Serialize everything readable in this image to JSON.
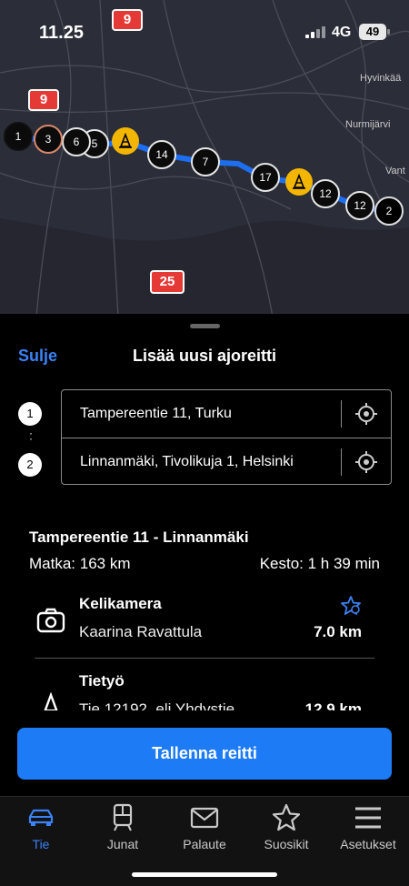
{
  "status_bar": {
    "time": "11.25",
    "network": "4G",
    "battery": "49"
  },
  "map": {
    "road_signs": [
      "9",
      "9",
      "25"
    ],
    "towns": [
      "Hyvinkää",
      "Nurmijärvi",
      "Vant"
    ],
    "markers": [
      "1",
      "3",
      "6",
      "5",
      "14",
      "7",
      "17",
      "12",
      "12",
      "2"
    ],
    "route_color": "#1e6ef0"
  },
  "sheet": {
    "close_label": "Sulje",
    "title": "Lisää uusi ajoreitti",
    "waypoints": [
      {
        "index": "1",
        "value": "Tampereentie 11, Turku"
      },
      {
        "index": "2",
        "value": "Linnanmäki, Tivolikuja 1, Helsinki"
      }
    ],
    "route": {
      "title": "Tampereentie 11  -  Linnanmäki",
      "distance": "Matka: 163 km",
      "duration": "Kesto: 1 h 39 min"
    },
    "items": [
      {
        "icon": "camera-icon",
        "name": "Kelikamera",
        "subtitle": "Kaarina Ravattula",
        "distance": "7.0 km"
      },
      {
        "icon": "roadwork-cone-icon",
        "name": "Tietyö",
        "subtitle": "Tie 12192, eli Yhdystie",
        "distance": "12.9 km"
      }
    ],
    "save_button": "Tallenna reitti"
  },
  "tabs": [
    {
      "label": "Tie",
      "icon": "car-icon",
      "active": true
    },
    {
      "label": "Junat",
      "icon": "train-icon",
      "active": false
    },
    {
      "label": "Palaute",
      "icon": "mail-icon",
      "active": false
    },
    {
      "label": "Suosikit",
      "icon": "star-icon",
      "active": false
    },
    {
      "label": "Asetukset",
      "icon": "menu-icon",
      "active": false
    }
  ],
  "colors": {
    "accent": "#1e7bf6",
    "cone": "#f2b600",
    "sign": "#e53935"
  }
}
